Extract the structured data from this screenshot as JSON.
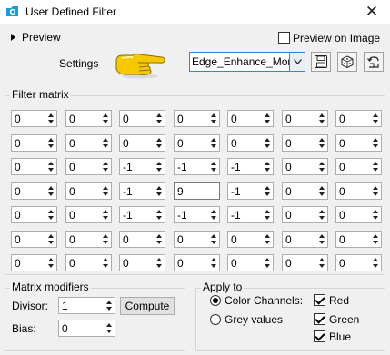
{
  "window": {
    "title": "User Defined Filter",
    "close_glyph": "✕"
  },
  "preview": {
    "label": "Preview",
    "preview_on_image_label": "Preview on Image",
    "preview_on_image_checked": false
  },
  "settings": {
    "label": "Settings",
    "preset_value": "Edge_Enhance_More"
  },
  "toolbar": {
    "icons": [
      "save-icon",
      "random-icon",
      "reset-icon"
    ]
  },
  "matrix": {
    "title": "Filter matrix",
    "rows": [
      [
        "0",
        "0",
        "0",
        "0",
        "0",
        "0",
        "0"
      ],
      [
        "0",
        "0",
        "0",
        "0",
        "0",
        "0",
        "0"
      ],
      [
        "0",
        "0",
        "-1",
        "-1",
        "-1",
        "0",
        "0"
      ],
      [
        "0",
        "0",
        "-1",
        "9",
        "-1",
        "0",
        "0"
      ],
      [
        "0",
        "0",
        "-1",
        "-1",
        "-1",
        "0",
        "0"
      ],
      [
        "0",
        "0",
        "0",
        "0",
        "0",
        "0",
        "0"
      ],
      [
        "0",
        "0",
        "0",
        "0",
        "0",
        "0",
        "0"
      ]
    ]
  },
  "modifiers": {
    "title": "Matrix modifiers",
    "divisor_label": "Divisor:",
    "divisor_value": "1",
    "bias_label": "Bias:",
    "bias_value": "0",
    "compute_label": "Compute"
  },
  "apply_to": {
    "title": "Apply to",
    "color_channels_label": "Color Channels:",
    "color_channels_selected": true,
    "grey_values_label": "Grey values",
    "grey_values_selected": false,
    "red_label": "Red",
    "red_checked": true,
    "green_label": "Green",
    "green_checked": true,
    "blue_label": "Blue",
    "blue_checked": true
  },
  "colors": {
    "accent": "#3c7fd6",
    "hand": "#f2c400"
  }
}
